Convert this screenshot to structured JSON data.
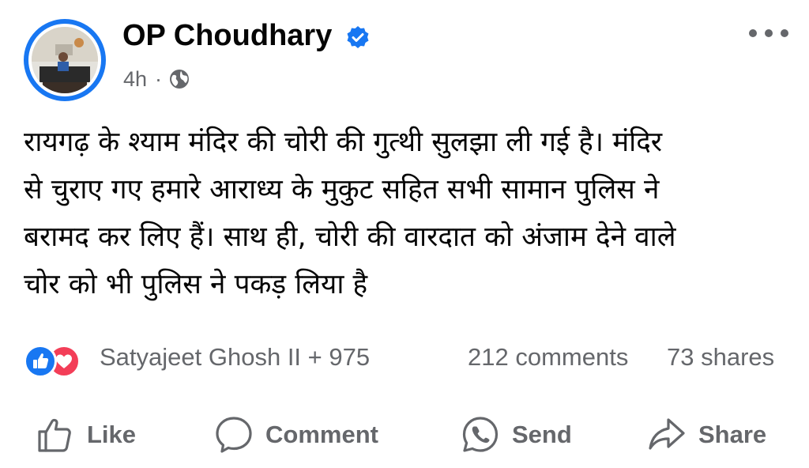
{
  "post": {
    "author": {
      "name": "OP Choudhary",
      "verified": true
    },
    "meta": {
      "time": "4h",
      "separator": "·",
      "audience_icon": "globe-icon"
    },
    "menu_icon": "more-horizontal-icon",
    "text": "रायगढ़ के श्याम मंदिर की चोरी की गुत्थी सुलझा ली गई है। मंदिर\nसे चुराए गए हमारे आराध्य के मुकुट सहित सभी सामान पुलिस ने\nबरामद कर लिए हैं। साथ ही, चोरी की वारदात को अंजाम देने वाले\nचोर को भी पुलिस ने पकड़ लिया है",
    "reactions": {
      "icons": [
        "like-reaction-icon",
        "love-reaction-icon"
      ],
      "summary": "Satyajeet Ghosh II + 975"
    },
    "comments_label": "212 comments",
    "shares_label": "73 shares",
    "actions": [
      {
        "label": "Like",
        "icon": "thumbs-up-icon"
      },
      {
        "label": "Comment",
        "icon": "comment-bubble-icon"
      },
      {
        "label": "Send",
        "icon": "messenger-whatsapp-icon"
      },
      {
        "label": "Share",
        "icon": "share-arrow-icon"
      }
    ]
  },
  "colors": {
    "brand_blue": "#1877f2",
    "love_red": "#f33e58",
    "secondary_text": "#65676b",
    "primary_text": "#050505"
  }
}
